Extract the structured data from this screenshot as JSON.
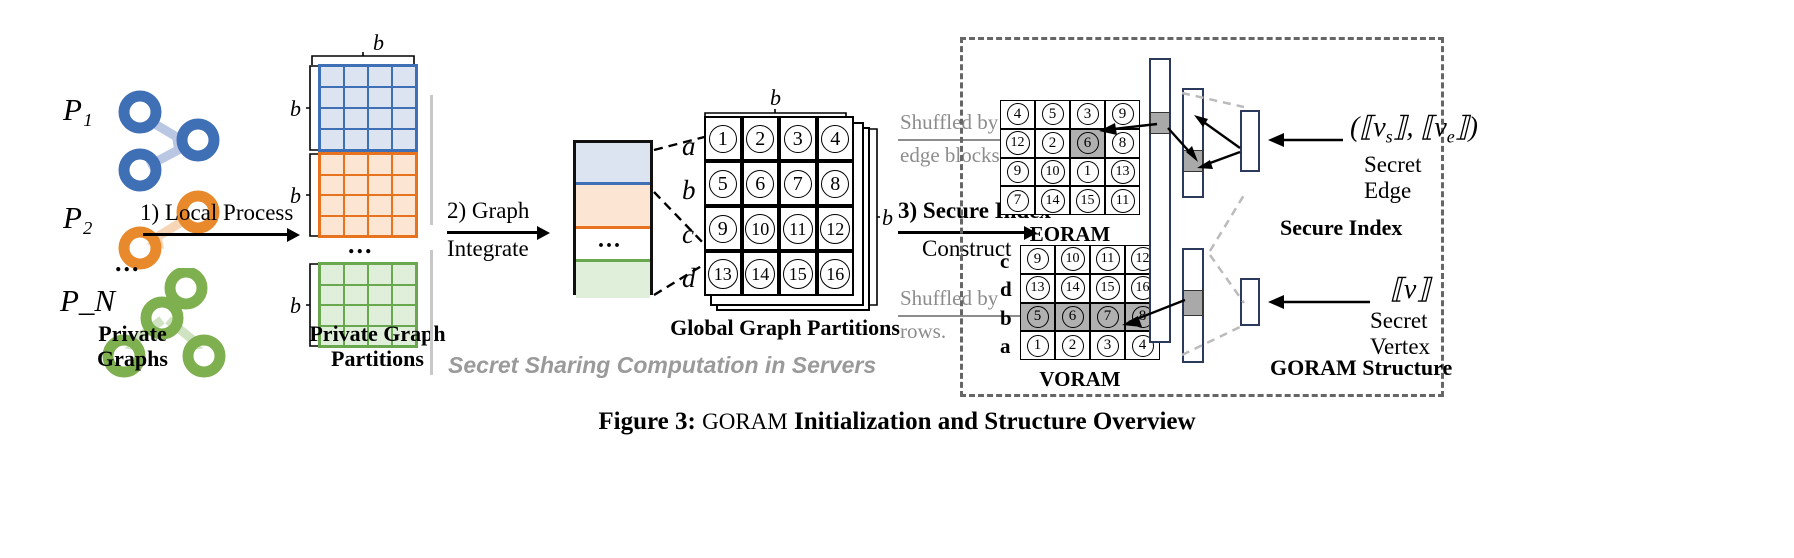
{
  "figure": {
    "caption_prefix": "Figure 3:",
    "caption_goram": "GORAM",
    "caption_rest": "Initialization and Structure Overview"
  },
  "parties": {
    "labels": [
      "P₁",
      "P₂",
      "P_N"
    ],
    "ellipsis": "...",
    "colors": [
      "#3f6fb5",
      "#e8892b",
      "#7fb050"
    ],
    "footer_line1": "Private",
    "footer_line2": "Graphs"
  },
  "private_partitions": {
    "footer_line1": "Private Graph",
    "footer_line2": "Partitions",
    "dim_label": "b",
    "ellipsis": "...",
    "matrices": [
      {
        "stroke": "#3f6fb5",
        "fill": "#dce3f1",
        "rows": 4,
        "cols": 4
      },
      {
        "stroke": "#e8731f",
        "fill": "#fce5d2",
        "rows": 4,
        "cols": 4
      },
      {
        "stroke": "#6aa84f",
        "fill": "#e0efd9",
        "rows": 4,
        "cols": 4
      }
    ]
  },
  "steps": [
    {
      "num": "1)",
      "line1": "Local Process",
      "line2": ""
    },
    {
      "num": "2)",
      "line1": "Graph",
      "line2": "Integrate"
    },
    {
      "num": "3)",
      "line1": "Secure Index",
      "line2": "Construct"
    }
  ],
  "stacked_bar": {
    "ellipsis": "...",
    "segments": [
      {
        "stroke": "#3f6fb5",
        "fill": "#dce3f1"
      },
      {
        "stroke": "#e8731f",
        "fill": "#fce5d2"
      },
      {
        "stroke": "#ffffff",
        "fill": "#ffffff"
      },
      {
        "stroke": "#6aa84f",
        "fill": "#e0efd9"
      }
    ]
  },
  "global_partitions": {
    "title": "Global Graph Partitions",
    "dim_label_top": "b",
    "dim_label_right": "b",
    "row_labels": [
      "a",
      "b",
      "c",
      "d"
    ],
    "cells": [
      [
        "1",
        "2",
        "3",
        "4"
      ],
      [
        "5",
        "6",
        "7",
        "8"
      ],
      [
        "9",
        "10",
        "11",
        "12"
      ],
      [
        "13",
        "14",
        "15",
        "16"
      ]
    ]
  },
  "shuffle_labels": {
    "edge": {
      "line1": "Shuffled by",
      "line2": "edge blocks."
    },
    "row": {
      "line1": "Shuffled by",
      "line2": "rows."
    }
  },
  "servers_note": "Secret Sharing Computation in Servers",
  "eoram": {
    "title": "EORAM",
    "cells": [
      [
        "4",
        "5",
        "3",
        "9"
      ],
      [
        "12",
        "2",
        "6",
        "8"
      ],
      [
        "9",
        "10",
        "1",
        "13"
      ],
      [
        "7",
        "14",
        "15",
        "11"
      ]
    ],
    "shaded": [
      [
        1,
        2
      ]
    ]
  },
  "voram": {
    "title": "VORAM",
    "row_labels": [
      "c",
      "d",
      "b",
      "a"
    ],
    "cells": [
      [
        "9",
        "10",
        "11",
        "12"
      ],
      [
        "13",
        "14",
        "15",
        "16"
      ],
      [
        "5",
        "6",
        "7",
        "8"
      ],
      [
        "1",
        "2",
        "3",
        "4"
      ]
    ],
    "shaded_rows": [
      2
    ]
  },
  "secure_index": {
    "title": "Secure Index",
    "edge_symbol": "(⟦v",
    "edge_sub_s": "s",
    "edge_mid": "⟧, ⟦v",
    "edge_sub_e": "e",
    "edge_end": "⟧)",
    "edge_caption": "Secret Edge",
    "vertex_symbol_open": "⟦v",
    "vertex_symbol_close": "⟧",
    "vertex_caption": "Secret Vertex"
  },
  "goram_structure": {
    "title": "GORAM Structure"
  },
  "colors": {
    "blue": "#3f6fb5",
    "orange": "#e8892b",
    "green": "#7fb050",
    "gray_text": "#8c8c8c",
    "index_stroke": "#2b3a5c",
    "shade": "#b0b0b0"
  }
}
